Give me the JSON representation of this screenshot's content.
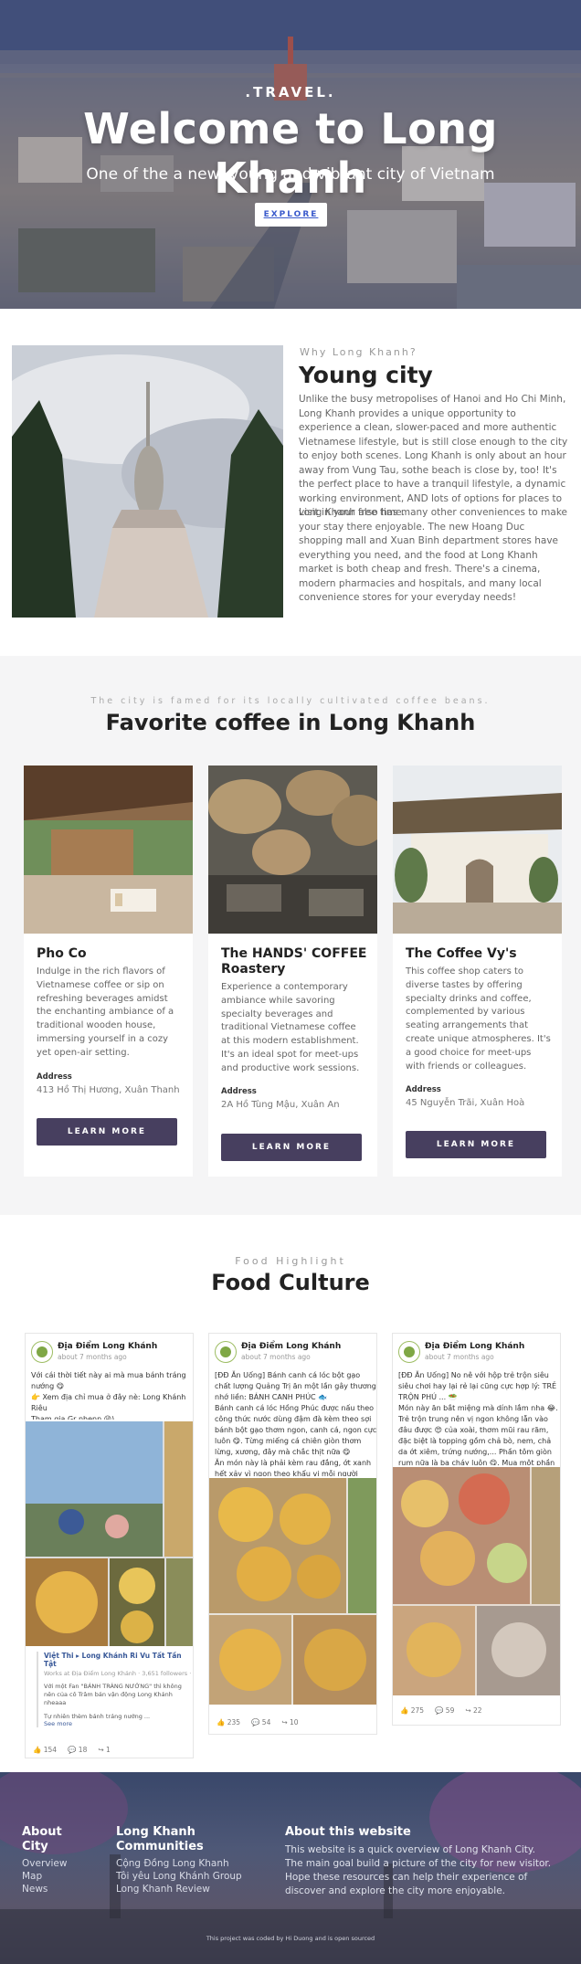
{
  "hero": {
    "kicker": ".TRAVEL.",
    "title": "Welcome to Long Khanh",
    "subtitle": "One of the a new, young and vibrant city of Vietnam",
    "button": "EXPLORE"
  },
  "why": {
    "kicker": "Why Long Khanh?",
    "title": "Young city",
    "p1": "Unlike the busy metropolises of Hanoi and Ho Chi Minh, Long Khanh provides a unique opportunity to experience a clean, slower-paced and more authentic Vietnamese lifestyle, but is still close enough to the city to enjoy both scenes. Long Khanh is only about an hour away from Vung Tau, sothe beach is close by, too! It's the perfect place to have a tranquil lifestyle, a dynamic working environment, AND lots of options for places to visit in your free time.",
    "p2": "Long Khanh also has many other conveniences to make your stay there enjoyable. The new Hoang Duc shopping mall and Xuan Binh department stores have everything you need, and the food at Long Khanh market is both cheap and fresh. There's a cinema, modern pharmacies and hospitals, and many local convenience stores for your everyday needs!"
  },
  "coffee": {
    "kicker": "The city is famed for its locally cultivated coffee beans.",
    "title": "Favorite coffee in Long Khanh",
    "address_label": "Address",
    "button": "LEARN MORE",
    "cards": [
      {
        "name": "Pho Co",
        "desc": "Indulge in the rich flavors of Vietnamese coffee or sip on refreshing beverages amidst the enchanting ambiance of a traditional wooden house, immersing yourself in a cozy yet open-air setting.",
        "address": "413 Hồ Thị Hương, Xuân Thanh"
      },
      {
        "name": "The HANDS' COFFEE Roastery",
        "desc": "Experience a contemporary ambiance while savoring specialty beverages and traditional Vietnamese coffee at this modern establishment. It's an ideal spot for meet-ups and productive work sessions.",
        "address": "2A Hồ Tùng Mậu, Xuân An"
      },
      {
        "name": "The Coffee Vy's",
        "desc": "This coffee shop caters to diverse tastes by offering specialty drinks and coffee, complemented by various seating arrangements that create unique atmospheres. It's a good choice for meet-ups with friends or colleagues.",
        "address": "45 Nguyễn Trãi, Xuân Hoà"
      }
    ]
  },
  "food": {
    "kicker": "Food Highlight",
    "title": "Food Culture",
    "posts": [
      {
        "page": "Địa Điểm Long Khánh",
        "date": "about 7 months ago",
        "text": "Với cái thời tiết này ai mà mua bánh tráng nướng 😋\n👉 Xem địa chỉ mua ở đây nè: Long Khánh Riêu\nTham gia Gr nhenn 😜)",
        "shared_title": "Việt Thi ▸ Long Khánh Ri Vu Tất Tần Tật",
        "shared_meta": "Works at Địa Điểm Long Khánh · 3,651 followers · Ju",
        "shared_text": "Với một Fan \"BÁNH TRÁNG NƯỚNG\" thì không nên của cô Trâm bán vận động Long Khánh nheaaa",
        "shared_more": "Tự nhiên thèm bánh tráng nướng ...",
        "see_more": "See more",
        "likes": "154",
        "comments": "18",
        "shares": "1"
      },
      {
        "page": "Địa Điểm Long Khánh",
        "date": "about 7 months ago",
        "text": "[ĐĐ Ăn Uống] Bánh canh cá lóc bột gạo chất lượng Quảng Trị ăn một lần gây thương nhớ liền: BÁNH CANH PHÚC 🐟\nBánh canh cá lóc Hồng Phúc được nấu theo công thức nước dùng đậm đà kèm theo sợi bánh bột gạo thơm ngon, canh cá, ngon cực luôn 😋. Từng miếng cá chiên giòn thơm lừng, xương, đây mà chắc thịt nữa 😋\nĂn món này là phải kèm rau đắng, ớt xanh hết xảy vì ngon theo khẩu vị mỗi người nghen 😂. Qu... See more",
        "likes": "235",
        "comments": "54",
        "shares": "10"
      },
      {
        "page": "Địa Điểm Long Khánh",
        "date": "about 7 months ago",
        "text": "[ĐĐ Ăn Uống] No nê với hộp trẻ trộn siêu siêu chơi hay lại rẻ lại cũng cực hợp lý: TRẺ TRỘN PHÚ ... 🥗\nMón này ăn bắt miệng mà dính lắm nha 😂. Trẻ trộn trung nên vị ngon không lẫn vào đâu được 😍 của xoài, thơm mũi rau răm, đặc biệt là topping gồm chả bò, nem, chả da ớt xiêm, trứng nướng,... Phần tôm giòn rụm nữa là ba cháy luôn 😋. Mua một phần chuyện ... See more",
        "likes": "275",
        "comments": "59",
        "shares": "22"
      }
    ]
  },
  "footer": {
    "about_city": {
      "title": "About City",
      "links": [
        "Overview",
        "Map",
        "News"
      ]
    },
    "communities": {
      "title": "Long Khanh Communities",
      "links": [
        "Cộng Đồng Long Khanh",
        "Tôi yêu Long Khánh Group",
        "Long Khanh Review"
      ]
    },
    "about_site": {
      "title": "About this website",
      "text": "This website is a quick overview of Long Khanh City. The main goal build a picture of the city for new visitor. Hope these resources can help their experience of discover and explore the city more enjoyable."
    },
    "copyright": "This project was coded by Hi Duong and is open sourced"
  }
}
